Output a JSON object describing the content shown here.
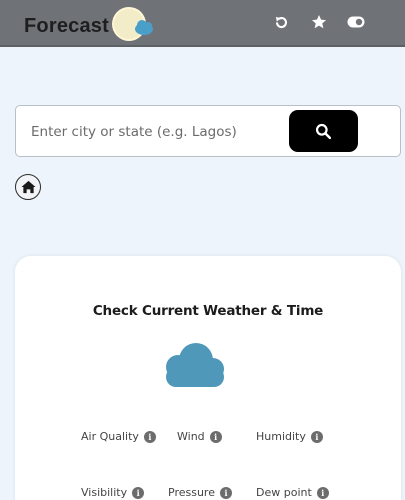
{
  "header": {
    "brand": "Forecast",
    "icons": [
      "refresh-icon",
      "star-icon",
      "toggle-icon",
      "moon-icon"
    ]
  },
  "search": {
    "placeholder": "Enter city or state (e.g. Lagos)",
    "value": ""
  },
  "card": {
    "title": "Check Current Weather & Time",
    "metrics": [
      {
        "label": "Air Quality"
      },
      {
        "label": "Wind"
      },
      {
        "label": "Humidity"
      },
      {
        "label": "Visibility"
      },
      {
        "label": "Pressure"
      },
      {
        "label": "Dew point"
      }
    ]
  },
  "colors": {
    "header_bg": "#6f7277",
    "page_bg": "#eef4fc",
    "cloud": "#4f98b9",
    "sun": "#f3e7b0",
    "search_button": "#000000"
  }
}
